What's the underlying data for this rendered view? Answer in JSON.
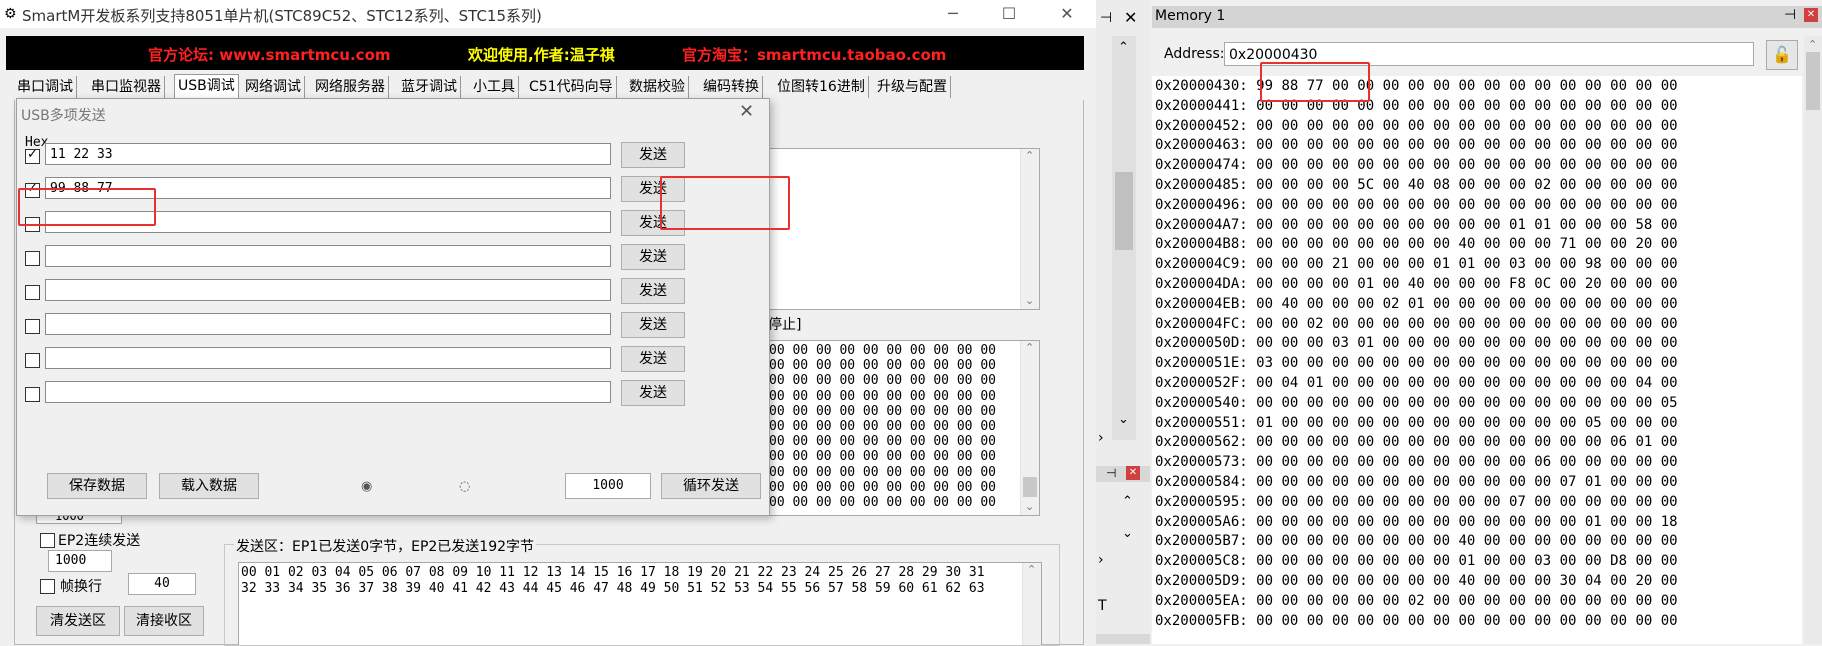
{
  "main_window": {
    "title": "SmartM开发板系列支持8051单片机(STC89C52、STC12系列、STC15系列)",
    "min": "─",
    "max": "☐",
    "close": "✕"
  },
  "banner": {
    "forum": "官方论坛: www.smartmcu.com",
    "welcome": "欢迎使用,作者:温子祺",
    "shop": "官方淘宝：smartmcu.taobao.com",
    "colors": {
      "forum": "#ff2020",
      "welcome": "#ffff00",
      "shop": "#ff2020"
    }
  },
  "tabs": [
    "串口调试",
    "串口监视器",
    "USB调试",
    "网络调试",
    "网络服务器",
    "蓝牙调试",
    "小工具",
    "C51代码向导",
    "数据校验",
    "编码转换",
    "位图转16进制",
    "升级与配置"
  ],
  "main": {
    "stop_label": "停止]",
    "interval_value": "1000",
    "ep2_label": "EP2连续发送",
    "ep2_value": "1000",
    "frame_label": "帧换行",
    "frame_value": "40",
    "clear_send": "清发送区",
    "clear_recv": "清接收区",
    "send_area_label": "发送区：EP1已发送0字节，EP2已发送192字节",
    "send_line1": "00 01 02 03 04 05 06 07 08 09 10 11 12 13 14 15 16 17 18 19 20 21 22 23 24 25 26 27 28 29 30 31",
    "send_line2": "32 33 34 35 36 37 38 39 40 41 42 43 44 45 46 47 48 49 50 51 52 53 54 55 56 57 58 59 60 61 62 63",
    "recv_line": "00 00 00 00 00 00 00 00 00 00",
    "recv_line_count": 11
  },
  "dialog": {
    "title": "USB多项发送",
    "hex_label": "Hex",
    "rows": [
      {
        "checked": true,
        "value": "11 22 33",
        "send": "发送"
      },
      {
        "checked": true,
        "value": "99 88 77",
        "send": "发送"
      },
      {
        "checked": false,
        "value": "",
        "send": "发送"
      },
      {
        "checked": false,
        "value": "",
        "send": "发送"
      },
      {
        "checked": false,
        "value": "",
        "send": "发送"
      },
      {
        "checked": false,
        "value": "",
        "send": "发送"
      },
      {
        "checked": false,
        "value": "",
        "send": "发送"
      },
      {
        "checked": false,
        "value": "",
        "send": "发送"
      }
    ],
    "save": "保存数据",
    "load": "载入数据",
    "interval": "1000",
    "loop": "循环发送",
    "highlight_color": "#e83030"
  },
  "memory": {
    "title": "Memory 1",
    "pin": "⊣",
    "close": "✕",
    "address_label": "Address:",
    "address_value": "0x20000430",
    "rows": [
      {
        "addr": "0x20000430:",
        "bytes": "99 88 77 00 00 00 00 00 00 00 00 00 00 00 00 00 00"
      },
      {
        "addr": "0x20000441:",
        "bytes": "00 00 00 00 00 00 00 00 00 00 00 00 00 00 00 00 00"
      },
      {
        "addr": "0x20000452:",
        "bytes": "00 00 00 00 00 00 00 00 00 00 00 00 00 00 00 00 00"
      },
      {
        "addr": "0x20000463:",
        "bytes": "00 00 00 00 00 00 00 00 00 00 00 00 00 00 00 00 00"
      },
      {
        "addr": "0x20000474:",
        "bytes": "00 00 00 00 00 00 00 00 00 00 00 00 00 00 00 00 00"
      },
      {
        "addr": "0x20000485:",
        "bytes": "00 00 00 00 5C 00 40 08 00 00 00 02 00 00 00 00 00"
      },
      {
        "addr": "0x20000496:",
        "bytes": "00 00 00 00 00 00 00 00 00 00 00 00 00 00 00 00 00"
      },
      {
        "addr": "0x200004A7:",
        "bytes": "00 00 00 00 00 00 00 00 00 00 01 01 00 00 00 58 00"
      },
      {
        "addr": "0x200004B8:",
        "bytes": "00 00 00 00 00 00 00 00 40 00 00 00 71 00 00 20 00"
      },
      {
        "addr": "0x200004C9:",
        "bytes": "00 00 00 21 00 00 00 01 01 00 03 00 00 98 00 00 00"
      },
      {
        "addr": "0x200004DA:",
        "bytes": "00 00 00 00 01 00 40 00 00 00 F8 0C 00 20 00 00 00"
      },
      {
        "addr": "0x200004EB:",
        "bytes": "00 40 00 00 00 02 01 00 00 00 00 00 00 00 00 00 00"
      },
      {
        "addr": "0x200004FC:",
        "bytes": "00 00 02 00 00 00 00 00 00 00 00 00 00 00 00 00 00"
      },
      {
        "addr": "0x2000050D:",
        "bytes": "00 00 00 03 01 00 00 00 00 00 00 00 00 00 00 00 00"
      },
      {
        "addr": "0x2000051E:",
        "bytes": "03 00 00 00 00 00 00 00 00 00 00 00 00 00 00 00 00"
      },
      {
        "addr": "0x2000052F:",
        "bytes": "00 04 01 00 00 00 00 00 00 00 00 00 00 00 00 04 00"
      },
      {
        "addr": "0x20000540:",
        "bytes": "00 00 00 00 00 00 00 00 00 00 00 00 00 00 00 00 05"
      },
      {
        "addr": "0x20000551:",
        "bytes": "01 00 00 00 00 00 00 00 00 00 00 00 00 05 00 00 00"
      },
      {
        "addr": "0x20000562:",
        "bytes": "00 00 00 00 00 00 00 00 00 00 00 00 00 00 06 01 00"
      },
      {
        "addr": "0x20000573:",
        "bytes": "00 00 00 00 00 00 00 00 00 00 00 06 00 00 00 00 00"
      },
      {
        "addr": "0x20000584:",
        "bytes": "00 00 00 00 00 00 00 00 00 00 00 00 07 01 00 00 00"
      },
      {
        "addr": "0x20000595:",
        "bytes": "00 00 00 00 00 00 00 00 00 00 07 00 00 00 00 00 00"
      },
      {
        "addr": "0x200005A6:",
        "bytes": "00 00 00 00 00 00 00 00 00 00 00 00 00 01 00 00 18"
      },
      {
        "addr": "0x200005B7:",
        "bytes": "00 00 00 00 00 00 00 00 40 00 00 00 00 00 00 00 00"
      },
      {
        "addr": "0x200005C8:",
        "bytes": "00 00 00 00 00 00 00 00 01 00 00 03 00 00 D8 00 00"
      },
      {
        "addr": "0x200005D9:",
        "bytes": "00 00 00 00 00 00 00 00 40 00 00 00 30 04 00 20 00"
      },
      {
        "addr": "0x200005EA:",
        "bytes": "00 00 00 00 00 00 02 00 00 00 00 00 00 00 00 00 00"
      },
      {
        "addr": "0x200005FB:",
        "bytes": "00 00 00 00 00 00 00 00 00 00 00 00 00 00 00 00 00"
      }
    ],
    "highlight_color": "#e83030"
  }
}
